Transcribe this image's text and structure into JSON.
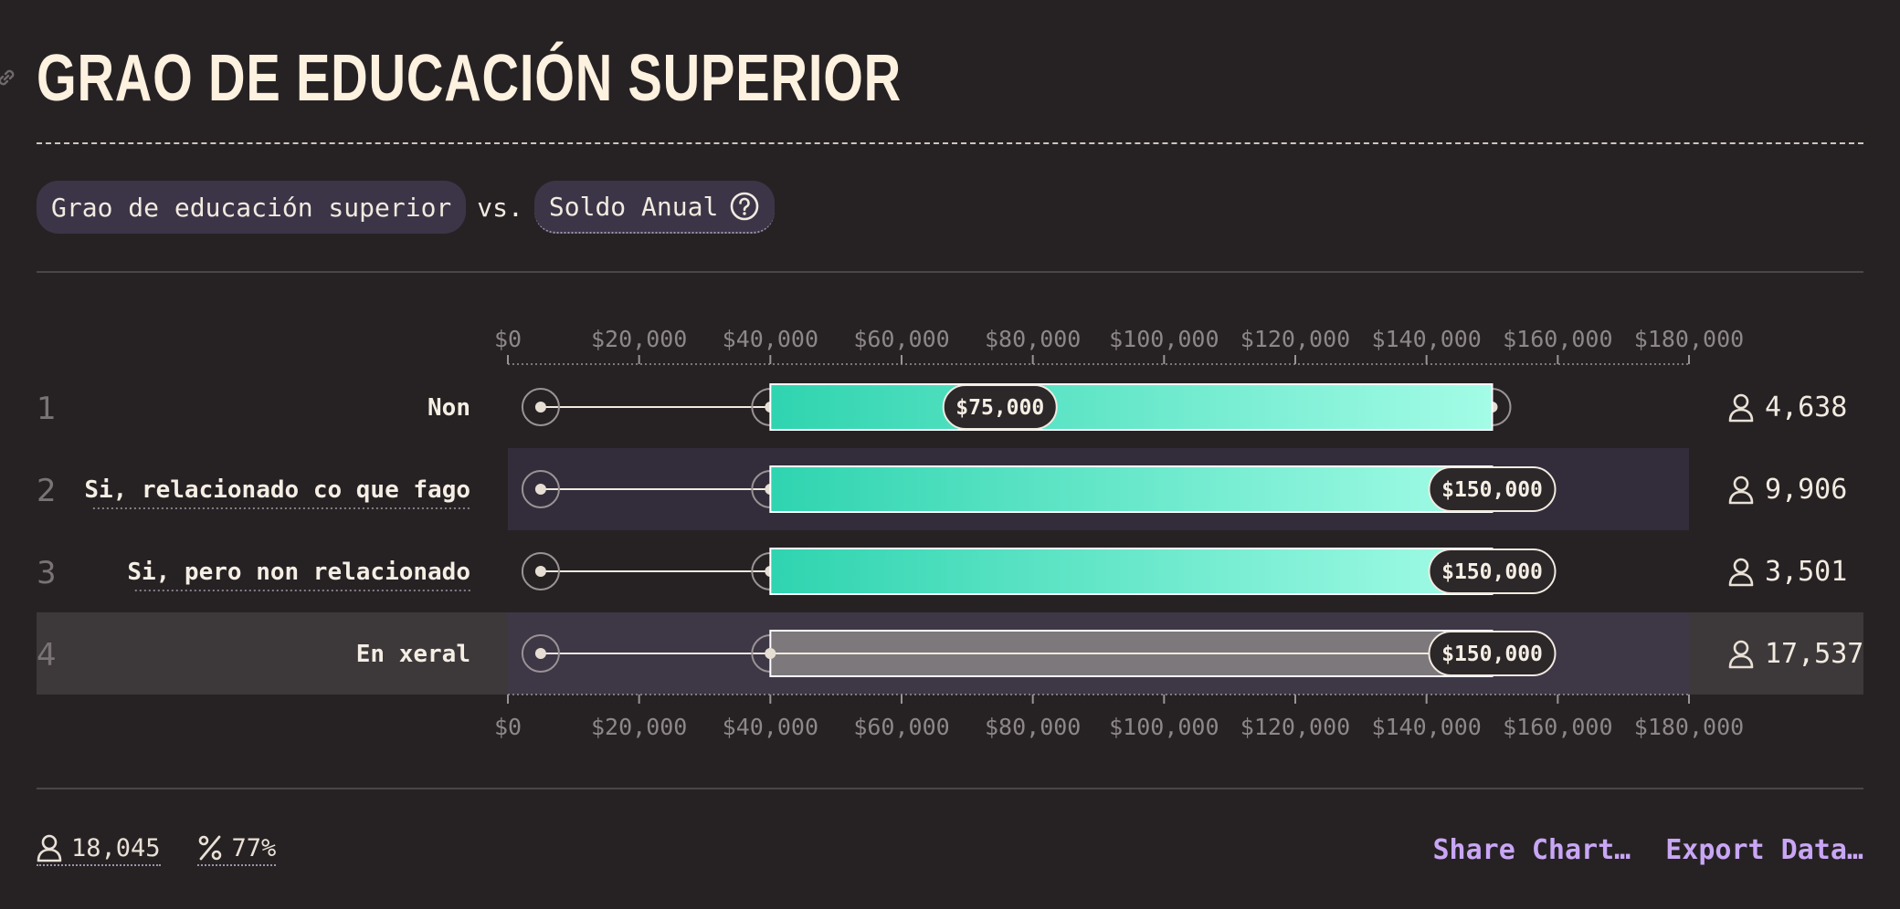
{
  "header": {
    "title": "GRAO DE EDUCACIÓN SUPERIOR"
  },
  "filters": {
    "dimension": "Grao de educación superior",
    "vs": "vs.",
    "metric": "Soldo Anual"
  },
  "chart_data": {
    "type": "boxplot",
    "axis": {
      "min": 0,
      "max": 180000,
      "ticks": [
        0,
        20000,
        40000,
        60000,
        80000,
        100000,
        120000,
        140000,
        160000,
        180000
      ],
      "tick_labels": [
        "$0",
        "$20,000",
        "$40,000",
        "$60,000",
        "$80,000",
        "$100,000",
        "$120,000",
        "$140,000",
        "$160,000",
        "$180,000"
      ]
    },
    "rows": [
      {
        "rank": "1",
        "label": "Non",
        "count": "4,638",
        "whisker_low": 5000,
        "box_low": 40000,
        "median": 75000,
        "box_high": 150000,
        "whisker_high": 150000,
        "median_label": "$75,000",
        "overall": false,
        "link": false
      },
      {
        "rank": "2",
        "label": "Si, relacionado co que fago",
        "count": "9,906",
        "whisker_low": 5000,
        "box_low": 40000,
        "median": 150000,
        "box_high": 150000,
        "whisker_high": 150000,
        "median_label": "$150,000",
        "overall": false,
        "link": true
      },
      {
        "rank": "3",
        "label": "Si, pero non relacionado",
        "count": "3,501",
        "whisker_low": 5000,
        "box_low": 40000,
        "median": 150000,
        "box_high": 150000,
        "whisker_high": 150000,
        "median_label": "$150,000",
        "overall": false,
        "link": true
      },
      {
        "rank": "4",
        "label": "En xeral",
        "count": "17,537",
        "whisker_low": 5000,
        "box_low": 40000,
        "median": 150000,
        "box_high": 150000,
        "whisker_high": 150000,
        "median_label": "$150,000",
        "overall": true,
        "link": false
      }
    ]
  },
  "footer": {
    "respondents": "18,045",
    "percent": "77%",
    "share_label": "Share Chart…",
    "export_label": "Export Data…"
  },
  "colors": {
    "background": "#262224",
    "bar_start": "#2fd4b0",
    "bar_end": "#a3fce6",
    "overall_bar": "#7d787b",
    "accent_link": "#c9a6f5",
    "row_highlight": "#332d3b",
    "overall_row": "#3d383a"
  }
}
